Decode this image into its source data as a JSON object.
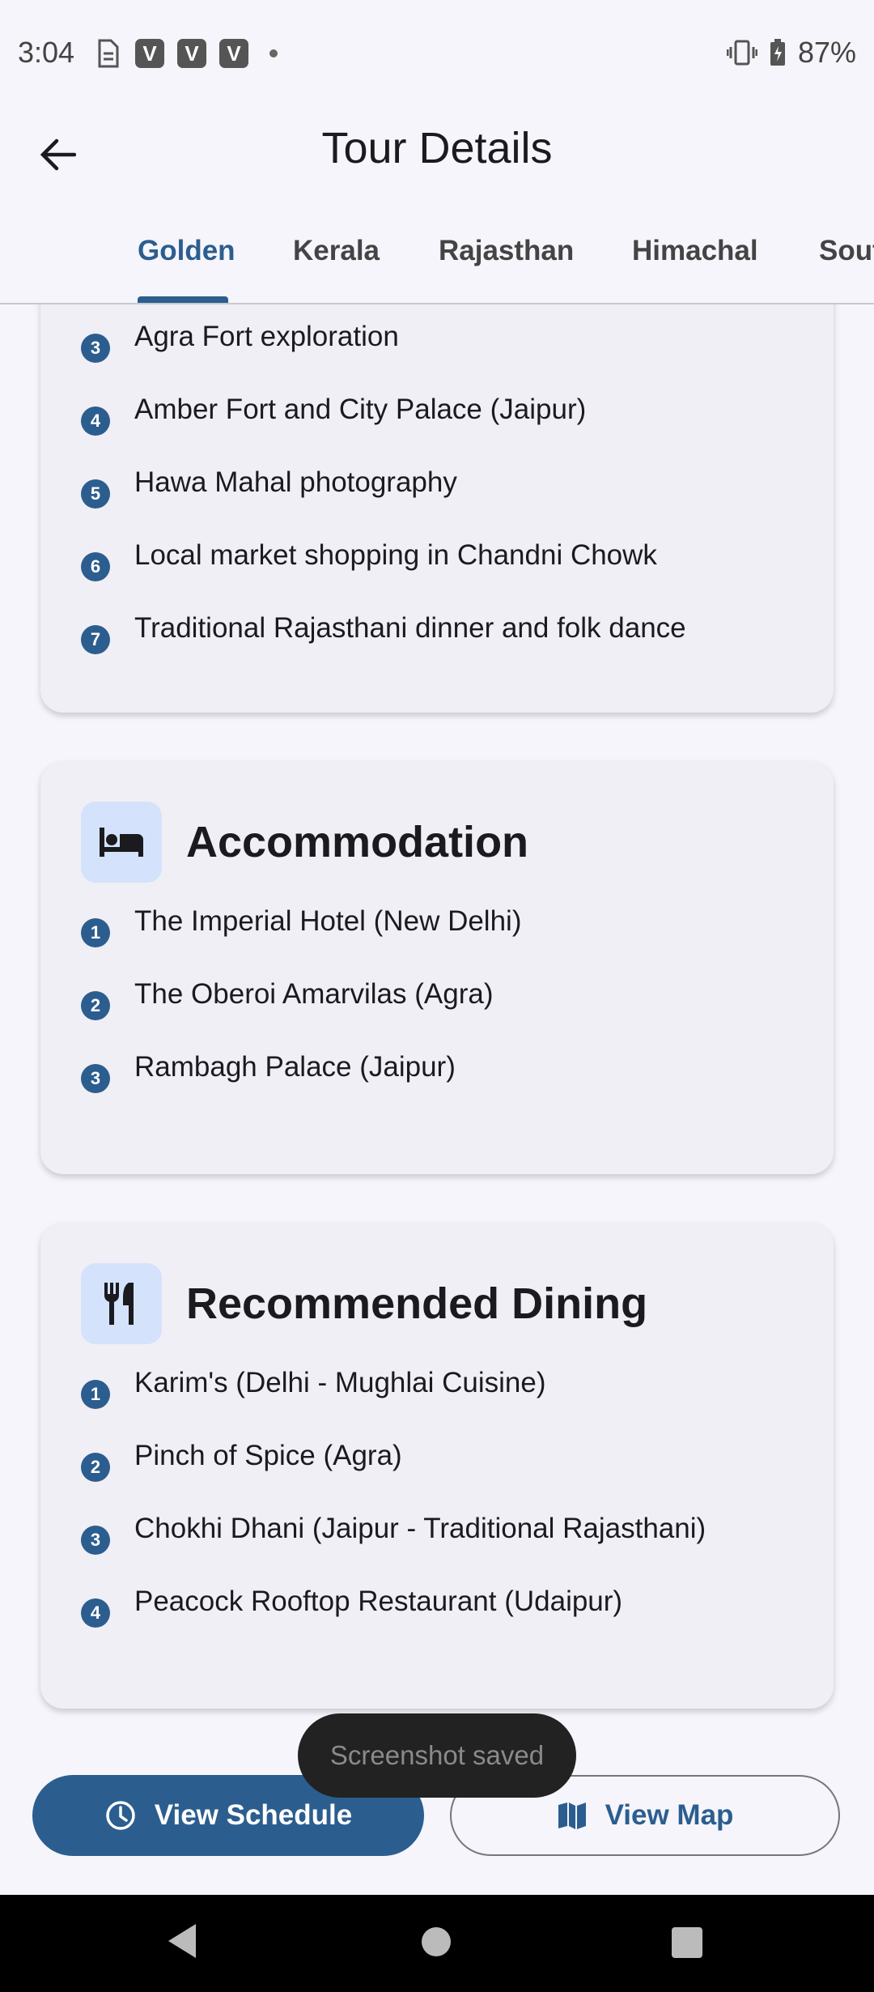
{
  "status_bar": {
    "time": "3:04",
    "left_icons": [
      "sim-icon",
      "v-app-icon",
      "v-app-icon",
      "v-app-icon",
      "dot-icon"
    ],
    "v_letter": "V",
    "battery": "87%"
  },
  "app_bar": {
    "title": "Tour Details"
  },
  "tabs": [
    {
      "label": "Golden",
      "active": true
    },
    {
      "label": "Kerala",
      "active": false
    },
    {
      "label": "Rajasthan",
      "active": false
    },
    {
      "label": "Himachal",
      "active": false
    },
    {
      "label": "Sout",
      "active": false
    }
  ],
  "activities_card": {
    "items": [
      {
        "num": "3",
        "text": "Agra Fort exploration"
      },
      {
        "num": "4",
        "text": "Amber Fort and City Palace (Jaipur)"
      },
      {
        "num": "5",
        "text": "Hawa Mahal photography"
      },
      {
        "num": "6",
        "text": "Local market shopping in Chandni Chowk"
      },
      {
        "num": "7",
        "text": "Traditional Rajasthani dinner and folk dance"
      }
    ]
  },
  "accommodation_card": {
    "title": "Accommodation",
    "icon": "bed-icon",
    "items": [
      {
        "num": "1",
        "text": "The Imperial Hotel (New Delhi)"
      },
      {
        "num": "2",
        "text": "The Oberoi Amarvilas (Agra)"
      },
      {
        "num": "3",
        "text": "Rambagh Palace (Jaipur)"
      }
    ]
  },
  "dining_card": {
    "title": "Recommended Dining",
    "icon": "restaurant-icon",
    "items": [
      {
        "num": "1",
        "text": "Karim's (Delhi - Mughlai Cuisine)"
      },
      {
        "num": "2",
        "text": "Pinch of Spice (Agra)"
      },
      {
        "num": "3",
        "text": "Chokhi Dhani (Jaipur - Traditional Rajasthani)"
      },
      {
        "num": "4",
        "text": "Peacock Rooftop Restaurant (Udaipur)"
      }
    ]
  },
  "buttons": {
    "schedule": "View Schedule",
    "map": "View Map"
  },
  "toast": "Screenshot saved",
  "colors": {
    "primary": "#2c5d8f",
    "icon_box": "#d4e3fb",
    "card": "#f0eff5",
    "background": "#f5f5fb"
  }
}
